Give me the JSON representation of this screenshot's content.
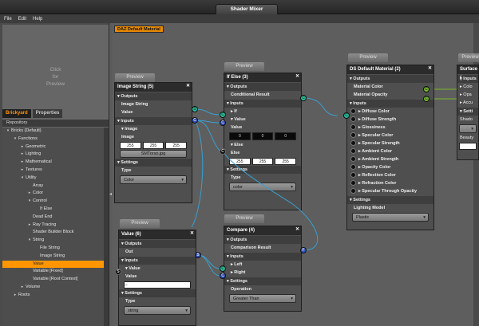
{
  "window": {
    "title": "Shader Mixer"
  },
  "menu": [
    "File",
    "Edit",
    "Help"
  ],
  "left": {
    "preview_hint": "Click\nfor\nPreview",
    "tabs": [
      "Brickyard",
      "Properties"
    ],
    "repository_label": "Repository",
    "tree": [
      {
        "label": "Bricks (Default)",
        "depth": 0,
        "arrow": "▾"
      },
      {
        "label": "Functions",
        "depth": 1,
        "arrow": "▾"
      },
      {
        "label": "Geometric",
        "depth": 2,
        "arrow": "▸"
      },
      {
        "label": "Lighting",
        "depth": 2,
        "arrow": "▸"
      },
      {
        "label": "Mathematical",
        "depth": 2,
        "arrow": "▸"
      },
      {
        "label": "Textures",
        "depth": 2,
        "arrow": "▸"
      },
      {
        "label": "Utility",
        "depth": 2,
        "arrow": "▾"
      },
      {
        "label": "Array",
        "depth": 3,
        "arrow": ""
      },
      {
        "label": "Color",
        "depth": 3,
        "arrow": "▸"
      },
      {
        "label": "Control",
        "depth": 3,
        "arrow": "▾"
      },
      {
        "label": "If Else",
        "depth": 4,
        "arrow": ""
      },
      {
        "label": "Dead End",
        "depth": 3,
        "arrow": ""
      },
      {
        "label": "Ray Tracing",
        "depth": 3,
        "arrow": "▸"
      },
      {
        "label": "Shader Builder Block",
        "depth": 3,
        "arrow": ""
      },
      {
        "label": "String",
        "depth": 3,
        "arrow": "▾"
      },
      {
        "label": "File String",
        "depth": 4,
        "arrow": ""
      },
      {
        "label": "Image String",
        "depth": 4,
        "arrow": ""
      },
      {
        "label": "Value",
        "depth": 3,
        "arrow": "",
        "selected": true
      },
      {
        "label": "Variable [Fixed]",
        "depth": 3,
        "arrow": ""
      },
      {
        "label": "Variable [Root Context]",
        "depth": 3,
        "arrow": ""
      },
      {
        "label": "Volume",
        "depth": 2,
        "arrow": "▸"
      },
      {
        "label": "Roots",
        "depth": 1,
        "arrow": "▸"
      }
    ]
  },
  "canvas": {
    "material_tag": "DAZ Default Material",
    "preview_label": "Preview",
    "image_string": {
      "title": "Image String (5)",
      "outputs": "Outputs",
      "out_image_string": "Image String",
      "out_value": "Value",
      "inputs": "Inputs",
      "image_group": "Image",
      "image_label": "Image",
      "rgb": [
        "255",
        "255",
        "255"
      ],
      "file_button": "SMTorso.jpg",
      "settings": "Settings",
      "type_label": "Type",
      "type_value": "Color"
    },
    "if_else": {
      "title": "If Else (3)",
      "outputs": "Outputs",
      "out_result": "Conditional Result",
      "inputs": "Inputs",
      "in_if": "If",
      "in_value": "Value",
      "value_label": "Value",
      "value_vals": [
        "0",
        "0",
        "0"
      ],
      "in_else": "Else",
      "else_label": "Else",
      "else_vals": [
        "255",
        "255",
        "255"
      ],
      "settings": "Settings",
      "type_label": "Type",
      "type_value": "color"
    },
    "ds_default": {
      "title": "DS Default Material (2)",
      "outputs": "Outputs",
      "out_color": "Material Color",
      "out_opacity": "Material Opacity",
      "inputs": "Inputs",
      "items": [
        "Diffuse Color",
        "Diffuse Strength",
        "Glossiness",
        "Specular Color",
        "Specular Strength",
        "Ambient Color",
        "Ambient Strength",
        "Opacity Color",
        "Reflection Color",
        "Refraction Color",
        "Specular Through Opacity"
      ],
      "settings": "Settings",
      "lighting_label": "Lighting Model",
      "lighting_value": "Plastic"
    },
    "surface": {
      "title": "Surface (",
      "inputs": "Inputs",
      "items": [
        "Colo",
        "Opa",
        "Accu"
      ],
      "settings": "Setti",
      "shadow": "Shado",
      "beauty": "Beauty"
    },
    "value_node": {
      "title": "Value (6)",
      "outputs": "Outputs",
      "out_label": "Out",
      "inputs": "Inputs",
      "in_value": "Value",
      "value_label": "Value",
      "value_field": "--",
      "settings": "Settings",
      "type_label": "Type",
      "type_value": "string"
    },
    "compare": {
      "title": "Compare (4)",
      "outputs": "Outputs",
      "out_result": "Comparison Result",
      "inputs": "Inputs",
      "in_left": "Left",
      "in_right": "Right",
      "settings": "Settings",
      "operation_label": "Operation",
      "operation_value": "Greater Than"
    },
    "port_letters": {
      "color": "C",
      "string": "S",
      "float": "F"
    }
  },
  "colors": {
    "accent": "#ff9600",
    "wire": "#3a9fd0",
    "port_green": "#2fb89b",
    "port_blue": "#2f4fbf"
  }
}
